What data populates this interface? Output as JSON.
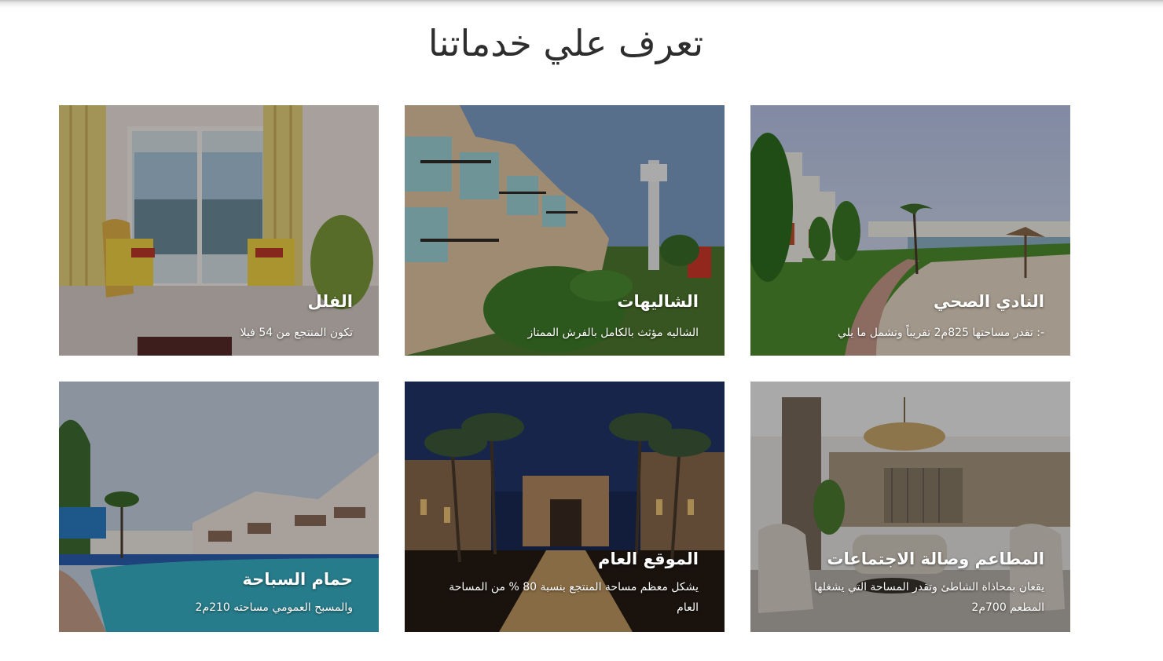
{
  "section": {
    "title": "تعرف علي خدماتنا"
  },
  "services": [
    {
      "title": "النادي الصحي",
      "description": "-: تقدر مساحتها 825م2 تقريباً وتشمل ما يلي"
    },
    {
      "title": "الشاليهات",
      "description": "الشاليه مؤثث بالكامل بالفرش الممتاز"
    },
    {
      "title": "الفلل",
      "description": "تكون المنتجع من 54 فيلا"
    },
    {
      "title": "المطاعم وصالة الاجتماعات",
      "description": "يقعان بمحاذاة الشاطئ وتقدر المساحة التي يشغلها المطعم 700م2"
    },
    {
      "title": "الموقع العام",
      "description": "يشكل معظم مساحة المنتجع بنسبة 80 % من المساحة العام"
    },
    {
      "title": "حمام السباحة",
      "description": "والمسبح العمومي مساحته 210م2"
    }
  ]
}
